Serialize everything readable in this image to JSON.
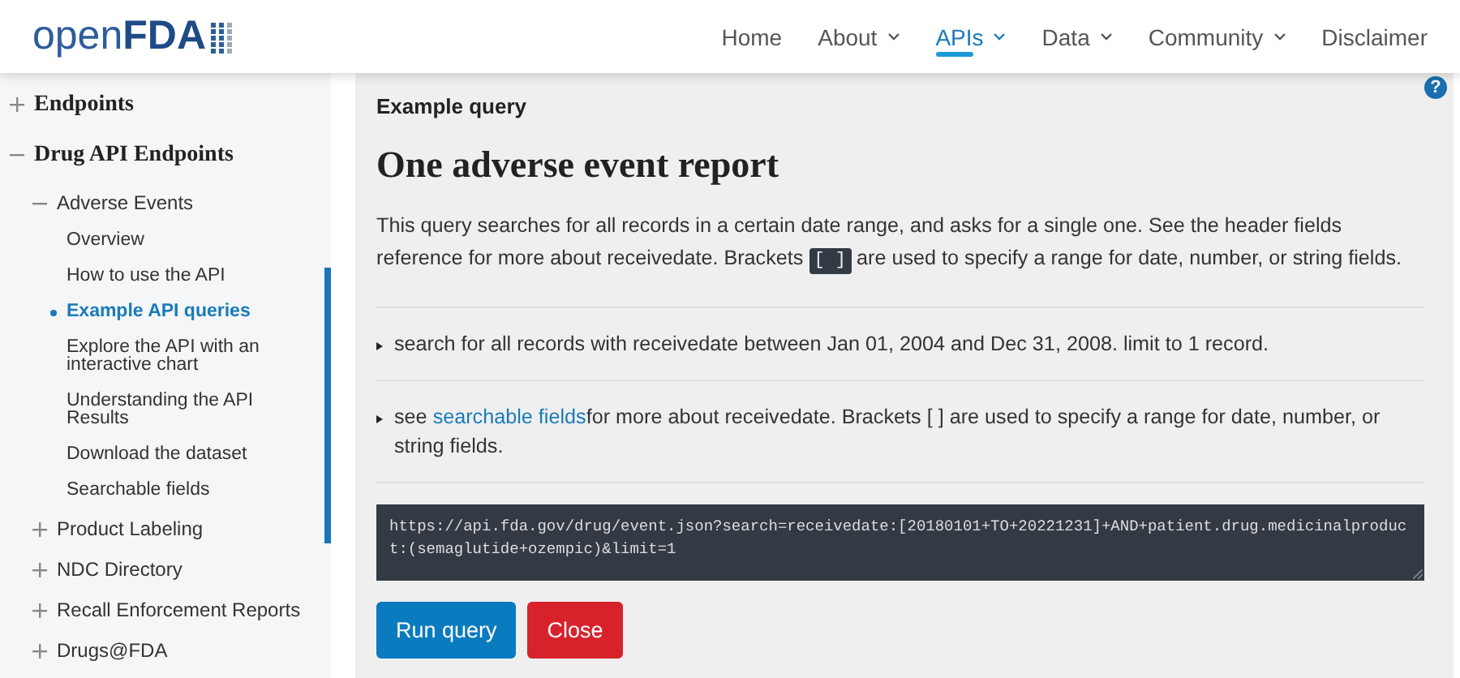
{
  "header": {
    "logo": {
      "light": "open",
      "bold": "FDA"
    },
    "nav": [
      {
        "label": "Home",
        "dropdown": false,
        "selected": false
      },
      {
        "label": "About",
        "dropdown": true,
        "selected": false
      },
      {
        "label": "APIs",
        "dropdown": true,
        "selected": true
      },
      {
        "label": "Data",
        "dropdown": true,
        "selected": false
      },
      {
        "label": "Community",
        "dropdown": true,
        "selected": false
      },
      {
        "label": "Disclaimer",
        "dropdown": false,
        "selected": false
      }
    ]
  },
  "sidebar": {
    "items": [
      {
        "label": "Endpoints",
        "expanded": false
      },
      {
        "label": "Drug API Endpoints",
        "expanded": true,
        "children": [
          {
            "label": "Adverse Events",
            "expanded": true,
            "children": [
              {
                "label": "Overview",
                "selected": false
              },
              {
                "label": "How to use the API",
                "selected": false
              },
              {
                "label": "Example API queries",
                "selected": true
              },
              {
                "label": "Explore the API with an interactive chart",
                "selected": false
              },
              {
                "label": "Understanding the API Results",
                "selected": false
              },
              {
                "label": "Download the dataset",
                "selected": false
              },
              {
                "label": "Searchable fields",
                "selected": false
              }
            ]
          },
          {
            "label": "Product Labeling",
            "expanded": false
          },
          {
            "label": "NDC Directory",
            "expanded": false
          },
          {
            "label": "Recall Enforcement Reports",
            "expanded": false
          },
          {
            "label": "Drugs@FDA",
            "expanded": false
          }
        ]
      }
    ]
  },
  "main": {
    "help": "?",
    "section_label": "Example query",
    "title": "One adverse event report",
    "description": {
      "before": "This query searches for all records in a certain date range, and asks for a single one. See the header fields reference for more about receivedate. Brackets ",
      "code": "[ ]",
      "after": " are used to specify a range for date, number, or string fields."
    },
    "steps": [
      {
        "before": "search for all records with receivedate between Jan 01, 2004 and Dec 31, 2008. limit to 1 record."
      },
      {
        "before": "see ",
        "link": "searchable fields",
        "after": "for more about receivedate. Brackets [ ] are used to specify a range for date, number, or string fields."
      }
    ],
    "query": "https://api.fda.gov/drug/event.json?search=receivedate:[20180101+TO+20221231]+AND+patient.drug.medicinalproduct:(semaglutide+ozempic)&limit=1",
    "buttons": [
      {
        "label": "Run query",
        "kind": "primary"
      },
      {
        "label": "Close",
        "kind": "danger"
      }
    ]
  }
}
